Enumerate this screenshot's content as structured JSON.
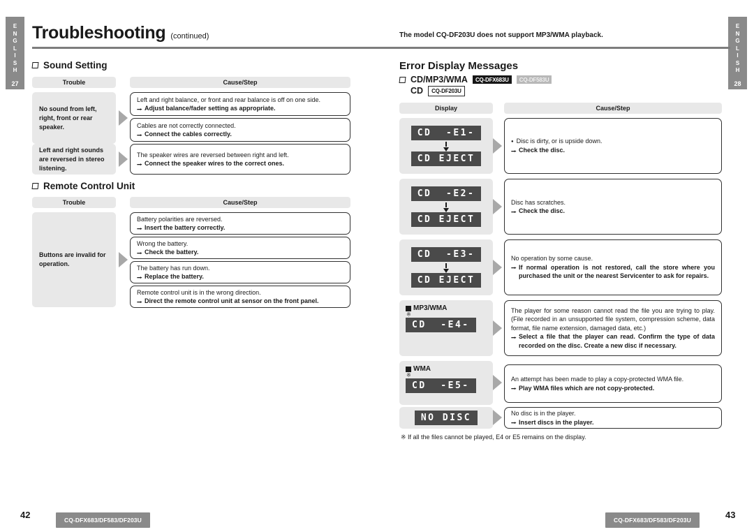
{
  "lang_tabs": {
    "left": {
      "label": "ENGLISH",
      "page": "27"
    },
    "right": {
      "label": "ENGLISH",
      "page": "28"
    }
  },
  "left_page": {
    "title": "Troubleshooting",
    "title_suffix": "(continued)",
    "sections": [
      {
        "heading": "Sound Setting",
        "col_trouble": "Trouble",
        "col_cause": "Cause/Step",
        "rows": [
          {
            "trouble": "No sound from left, right, front or rear speaker.",
            "items": [
              {
                "cause": "Left and right balance, or front and rear balance is off on one side.",
                "step": "Adjust balance/fader setting as appropriate."
              },
              {
                "cause": "Cables are not correctly connected.",
                "step": "Connect the cables correctly."
              }
            ]
          },
          {
            "trouble": "Left and right sounds are reversed in stereo listening.",
            "items": [
              {
                "cause": "The speaker wires are reversed between right and left.",
                "step": "Connect the speaker wires to the correct ones."
              }
            ]
          }
        ]
      },
      {
        "heading": "Remote Control Unit",
        "col_trouble": "Trouble",
        "col_cause": "Cause/Step",
        "rows": [
          {
            "trouble": "Buttons are invalid for operation.",
            "items": [
              {
                "cause": "Battery polarities are reversed.",
                "step": "Insert the battery correctly."
              },
              {
                "cause": "Wrong the battery.",
                "step": "Check the battery."
              },
              {
                "cause": "The battery has run down.",
                "step": "Replace the battery."
              },
              {
                "cause": "Remote control unit is in the wrong direction.",
                "step": "Direct the remote control unit at sensor on the front panel."
              }
            ]
          }
        ]
      }
    ]
  },
  "right_page": {
    "model_note": "The model CQ-DF203U does not support MP3/WMA playback.",
    "title": "Error Display Messages",
    "subhead_1": {
      "label": "CD/MP3/WMA",
      "badges": [
        {
          "text": "CQ-DFX683U",
          "style": "dark"
        },
        {
          "text": "CQ-DF583U",
          "style": "grey"
        }
      ]
    },
    "subhead_2": {
      "label": "CD",
      "badges": [
        {
          "text": "CQ-DF203U",
          "style": "outline"
        }
      ]
    },
    "col_display": "Display",
    "col_cause": "Cause/Step",
    "rows": [
      {
        "format_label": null,
        "asterisk": false,
        "lcd_top": "CD  -E1-",
        "lcd_bottom": "CD EJECT",
        "cause_bullet": true,
        "cause": "Disc is dirty, or is upside down.",
        "step": "Check the disc."
      },
      {
        "format_label": null,
        "asterisk": false,
        "lcd_top": "CD  -E2-",
        "lcd_bottom": "CD EJECT",
        "cause_bullet": false,
        "cause": "Disc has scratches.",
        "step": "Check the disc."
      },
      {
        "format_label": null,
        "asterisk": false,
        "lcd_top": "CD  -E3-",
        "lcd_bottom": "CD EJECT",
        "cause_bullet": false,
        "cause": "No operation by some cause.",
        "step": "If normal operation is not restored, call the store where you purchased the unit or the nearest Servicenter to ask for repairs."
      },
      {
        "format_label": "MP3/WMA",
        "asterisk": true,
        "lcd_top": "CD  -E4-",
        "lcd_bottom": null,
        "cause_bullet": false,
        "cause": "The player for some reason cannot read the file you are trying to play. (File recorded in an unsupported file system, compression scheme, data format, file name extension, damaged data, etc.)",
        "step": "Select a file that the player can read. Confirm the type of data recorded on the disc. Create a new disc if necessary."
      },
      {
        "format_label": "WMA",
        "asterisk": true,
        "lcd_top": "CD  -E5-",
        "lcd_bottom": null,
        "cause_bullet": false,
        "cause": "An attempt has been made to play a copy-protected WMA file.",
        "step": "Play WMA files which are not copy-protected."
      },
      {
        "format_label": null,
        "asterisk": false,
        "lcd_top": "NO DISC",
        "lcd_bottom": null,
        "cause_bullet": false,
        "cause": "No disc is in the player.",
        "step": "Insert discs in the player."
      }
    ],
    "footnote": "※ If all the files cannot be played, E4 or E5 remains on the display."
  },
  "footer": {
    "model_left": "CQ-DFX683/DF583/DF203U",
    "model_right": "CQ-DFX683/DF583/DF203U",
    "page_left": "42",
    "page_right": "43"
  },
  "colors": {
    "tab_grey": "#8a8a8a",
    "panel_grey": "#e8e8e8",
    "lcd_bg": "#4a4a4a",
    "rule": "#7d7d7d",
    "arrow": "#a8a8a8"
  }
}
